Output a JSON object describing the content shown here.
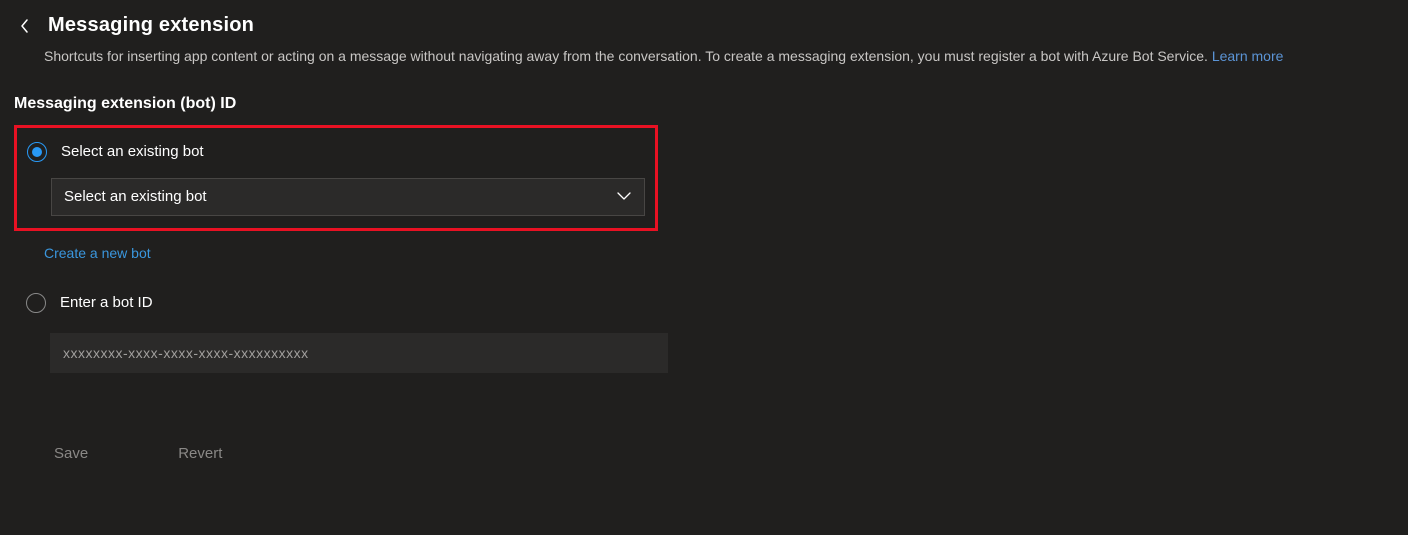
{
  "header": {
    "title": "Messaging extension",
    "description_prefix": "Shortcuts for inserting app content or acting on a message without navigating away from the conversation. To create a messaging extension, you must register a bot with Azure Bot Service. ",
    "learn_more": "Learn more"
  },
  "section": {
    "label": "Messaging extension (bot) ID",
    "option_select": {
      "label": "Select an existing bot",
      "dropdown_placeholder": "Select an existing bot",
      "selected": true
    },
    "create_link": "Create a new bot",
    "option_enter": {
      "label": "Enter a bot ID",
      "placeholder": "xxxxxxxx-xxxx-xxxx-xxxx-xxxxxxxxxx",
      "selected": false
    }
  },
  "footer": {
    "save": "Save",
    "revert": "Revert"
  },
  "colors": {
    "accent": "#2899f5",
    "highlight_border": "#e81123",
    "link": "#3a96dd"
  }
}
